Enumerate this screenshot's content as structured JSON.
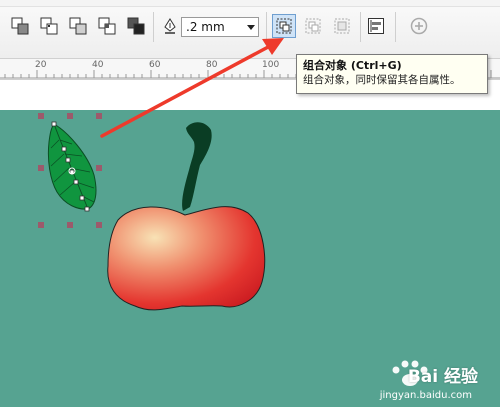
{
  "toolbar": {
    "outline_width": ".2 mm",
    "buttons": [
      "combine-icon",
      "weld-icon",
      "trim-icon",
      "intersect-icon",
      "simplify-icon",
      "front-minus-back-icon",
      "pen-nib-icon",
      "group-objects-icon",
      "ungroup-icon",
      "ungroup-all-icon",
      "align-distribute-icon",
      "add-icon"
    ]
  },
  "ruler": {
    "labels": [
      "20",
      "40",
      "60",
      "80",
      "100"
    ]
  },
  "tooltip": {
    "title": "组合对象 (Ctrl+G)",
    "description": "组合对象，同时保留其各自属性。"
  },
  "watermark": {
    "brand": "Bai 经验",
    "url": "jingyan.baidu.com"
  },
  "colors": {
    "canvas": "#56a391",
    "leaf": "#10953f",
    "stem": "#0a3d24",
    "apple_highlight": "#f8e2b5",
    "apple_base": "#e2262a",
    "arrow": "#ee3a2b",
    "handles": "#9c5a6b"
  }
}
